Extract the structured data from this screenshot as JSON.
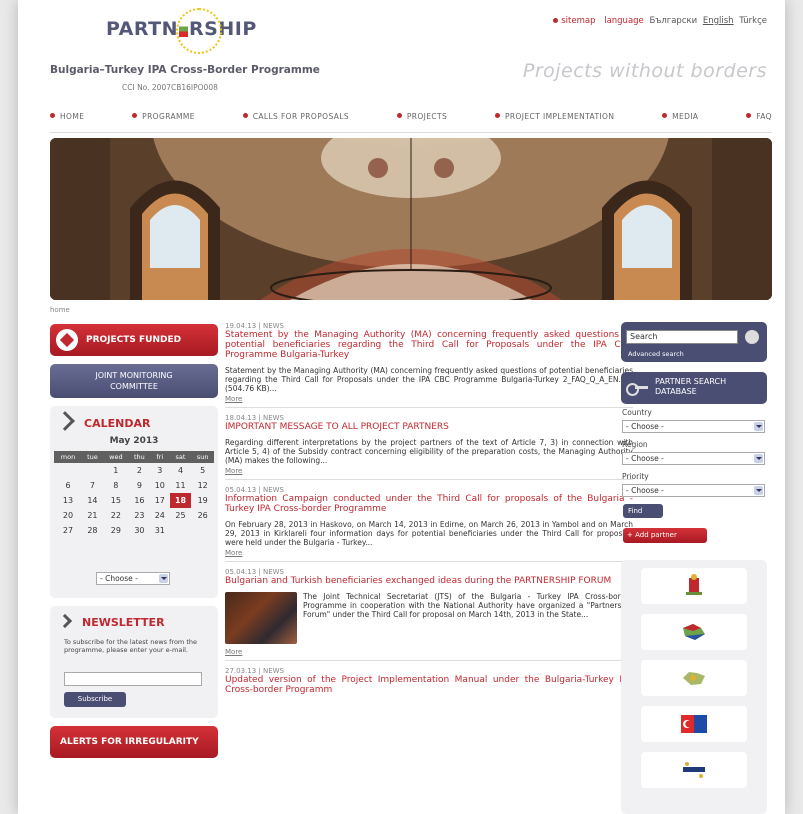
{
  "header": {
    "logo_left": "PARTN",
    "logo_right": "RSHIP",
    "programme_title": "Bulgaria–Turkey IPA Cross-Border Programme",
    "cci_no": "CCI No. 2007CB16IPO008",
    "slogan": "Projects without borders",
    "top_links": {
      "sitemap": "sitemap",
      "language": "language",
      "lang_bg": "Български",
      "lang_en": "English",
      "lang_tr": "Türkçe"
    }
  },
  "nav": [
    "HOME",
    "PROGRAMME",
    "CALLS FOR PROPOSALS",
    "PROJECTS",
    "PROJECT IMPLEMENTATION",
    "MEDIA",
    "FAQ"
  ],
  "breadcrumb": "home",
  "left": {
    "projects_funded": "PROJECTS FUNDED",
    "jmc_line1": "JOINT MONITORING",
    "jmc_line2": "COMMITTEE",
    "calendar": {
      "title": "CALENDAR",
      "month": "May 2013",
      "days": [
        "mon",
        "tue",
        "wed",
        "thu",
        "fri",
        "sat",
        "sun"
      ],
      "weeks": [
        [
          "",
          "",
          "1",
          "2",
          "3",
          "4",
          "5"
        ],
        [
          "6",
          "7",
          "8",
          "9",
          "10",
          "11",
          "12"
        ],
        [
          "13",
          "14",
          "15",
          "16",
          "17",
          "18",
          "19"
        ],
        [
          "20",
          "21",
          "22",
          "23",
          "24",
          "25",
          "26"
        ],
        [
          "27",
          "28",
          "29",
          "30",
          "31",
          "",
          ""
        ]
      ],
      "today": "18",
      "select": "- Choose -"
    },
    "newsletter": {
      "title": "NEWSLETTER",
      "text": "To subscribe for the latest news from the programme, please enter your e-mail.",
      "button": "Subscribe"
    },
    "alerts": "ALERTS FOR IRREGULARITY"
  },
  "articles": [
    {
      "date": "19.04.13 | NEWS",
      "title": "Statement by the Managing Authority (MA) concerning frequently asked questions of potential beneficiaries regarding the Third Call for Proposals under the IPA CBC Programme Bulgaria-Turkey",
      "text": "Statement by the Managing Authority (MA) concerning frequently asked questions of potential beneficiaries regarding the Third Call for Proposals under the IPA CBC Programme Bulgaria-Turkey 2_FAQ_Q_A_EN.pdf (504.76 KB)...",
      "more": "More"
    },
    {
      "date": "18.04.13 | NEWS",
      "title": "IMPORTANT MESSAGE TO ALL PROJECT PARTNERS",
      "text": "Regarding different interpretations by the project partners of the text of Article 7, 3) in connection with Article 5, 4) of the Subsidy contract concerning eligibility of the preparation costs, the Managing Authority (MA) makes the following...",
      "more": "More"
    },
    {
      "date": "05.04.13 | NEWS",
      "title": "Information Campaign conducted under the Third Call for proposals of the Bulgaria - Turkey IPA Cross-border Programme",
      "text": "On February 28, 2013 in Haskovo, on March 14, 2013 in Edirne, on March 26, 2013 in Yambol and on March 29, 2013 in Kirklareli four information days for potential beneficiaries under the Third Call for proposals were held under the Bulgaria - Turkey...",
      "more": "More"
    },
    {
      "date": "05.04.13 | NEWS",
      "title": "Bulgarian and Turkish beneficiaries exchanged ideas during the PARTNERSHIP FORUM",
      "text": "The Joint Technical Secretariat (JTS) of the Bulgaria - Turkey IPA Cross-border Programme in cooperation with the National Authority have organized a \"Partnership Forum\" under the Third Call for proposal on March 14th, 2013 in the State...",
      "more": "More"
    },
    {
      "date": "27.03.13 | NEWS",
      "title": "Updated version of the Project Implementation Manual under the Bulgaria-Turkey IPA Cross-border Programm",
      "text": "",
      "more": ""
    }
  ],
  "right": {
    "search_value": "Search",
    "advanced": "Advanced search",
    "psd_line1": "PARTNER SEARCH",
    "psd_line2": "DATABASE",
    "country_label": "Country",
    "region_label": "Region",
    "priority_label": "Priority",
    "choose": "- Choose -",
    "find": "Find",
    "add_partner": "+ Add partner"
  },
  "colors": {
    "accent_red": "#c0282f",
    "navy": "#4b4e73",
    "panel": "#f1f1f3"
  }
}
